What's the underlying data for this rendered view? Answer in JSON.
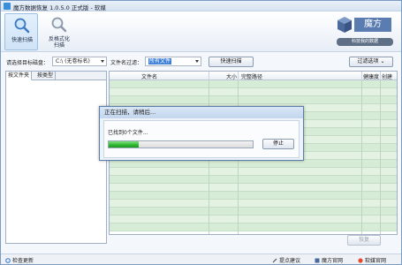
{
  "window": {
    "title": "魔方数据恢复 1.0.5.0 正式版 - 软媒"
  },
  "ribbon": {
    "quick_scan_label": "快速扫描",
    "deep_scan_label_line1": "反格式化",
    "deep_scan_label_line2": "扫描",
    "logo_text": "魔方",
    "logo_sub": "科技我的数据"
  },
  "toolbar": {
    "disk_label": "请选择目标磁盘：",
    "disk_value": "C:\\ (无卷标名)",
    "filter_label": "文件名过滤：",
    "filter_value": "所有文件",
    "scan_button": "快速扫描",
    "filter_options_button": "过滤选项"
  },
  "left_panel": {
    "tabs": [
      "按文件夹",
      "按类型"
    ]
  },
  "list": {
    "columns": [
      "文件名",
      "大小",
      "完整路径",
      "健康度",
      "创建"
    ]
  },
  "dialog": {
    "title": "正在扫描，请稍后...",
    "status": "已找到0个文件...",
    "progress_percent": 21,
    "stop_button": "停止"
  },
  "actions": {
    "recover_button": "恢复"
  },
  "statusbar": {
    "update_check": "检查更新",
    "suggestion": "提点建议",
    "mofang_site": "魔方官网",
    "ruanmei_site": "软媒官网"
  },
  "colors": {
    "accent": "#3b7fd6",
    "progress": "#2fb52f",
    "row_green": "#d7ecd6"
  }
}
